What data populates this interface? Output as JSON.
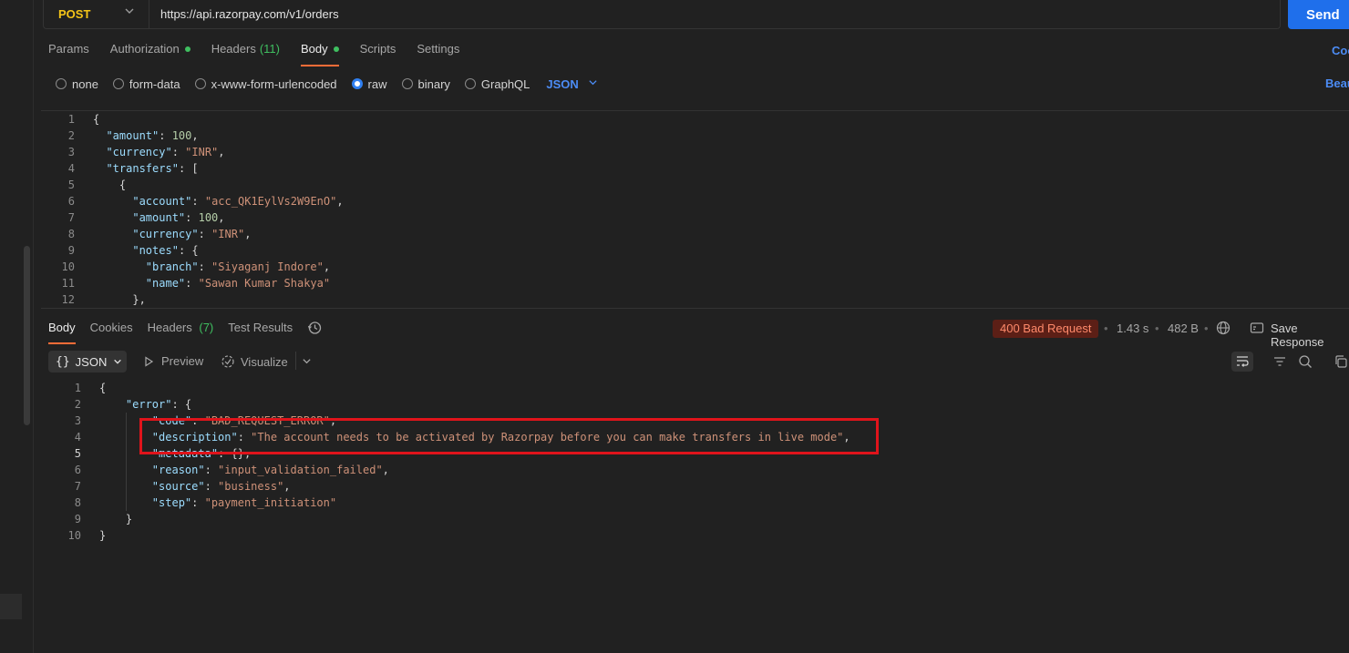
{
  "request": {
    "method": "POST",
    "url": "https://api.razorpay.com/v1/orders",
    "send_label": "Send",
    "tabs": [
      {
        "label": "Params"
      },
      {
        "label": "Authorization",
        "dot": true
      },
      {
        "label": "Headers",
        "count": "(11)"
      },
      {
        "label": "Body",
        "dot": true,
        "active": true
      },
      {
        "label": "Scripts"
      },
      {
        "label": "Settings"
      }
    ],
    "right_link": "Coo",
    "beautify_link": "Beau",
    "body_types": [
      "none",
      "form-data",
      "x-www-form-urlencoded",
      "raw",
      "binary",
      "GraphQL"
    ],
    "body_type_selected": "raw",
    "format": "JSON",
    "code_lines": [
      "1",
      "2",
      "3",
      "4",
      "5",
      "6",
      "7",
      "8",
      "9",
      "10",
      "11",
      "12"
    ],
    "body": {
      "amount_key": "\"amount\"",
      "amount_val": "100",
      "currency_key": "\"currency\"",
      "currency_val": "\"INR\"",
      "transfers_key": "\"transfers\"",
      "account_key": "\"account\"",
      "account_val": "\"acc_QK1EylVs2W9EnO\"",
      "t_amount_key": "\"amount\"",
      "t_amount_val": "100",
      "t_currency_key": "\"currency\"",
      "t_currency_val": "\"INR\"",
      "notes_key": "\"notes\"",
      "branch_key": "\"branch\"",
      "branch_val": "\"Siyaganj Indore\"",
      "name_key": "\"name\"",
      "name_val": "\"Sawan Kumar Shakya\""
    }
  },
  "response": {
    "tabs": [
      {
        "label": "Body",
        "active": true
      },
      {
        "label": "Cookies"
      },
      {
        "label": "Headers",
        "count": "(7)"
      },
      {
        "label": "Test Results"
      }
    ],
    "status": "400 Bad Request",
    "time": "1.43 s",
    "size": "482 B",
    "save_label": "Save Response",
    "format": "JSON",
    "preview_label": "Preview",
    "visualize_label": "Visualize",
    "body": {
      "error_key": "\"error\"",
      "code_key": "\"code\"",
      "code_val": "\"BAD_REQUEST_ERROR\"",
      "description_key": "\"description\"",
      "description_val": "\"The account needs to be activated by Razorpay before you can make transfers in live mode\"",
      "metadata_key": "\"metadata\"",
      "reason_key": "\"reason\"",
      "reason_val": "\"input_validation_failed\"",
      "source_key": "\"source\"",
      "source_val": "\"business\"",
      "step_key": "\"step\"",
      "step_val": "\"payment_initiation\""
    }
  },
  "colors": {
    "accent": "#ff6c37",
    "method": "#f5c518",
    "send": "#1f6feb",
    "error_status": "#ff8a6b",
    "highlight": "#e0141b"
  }
}
